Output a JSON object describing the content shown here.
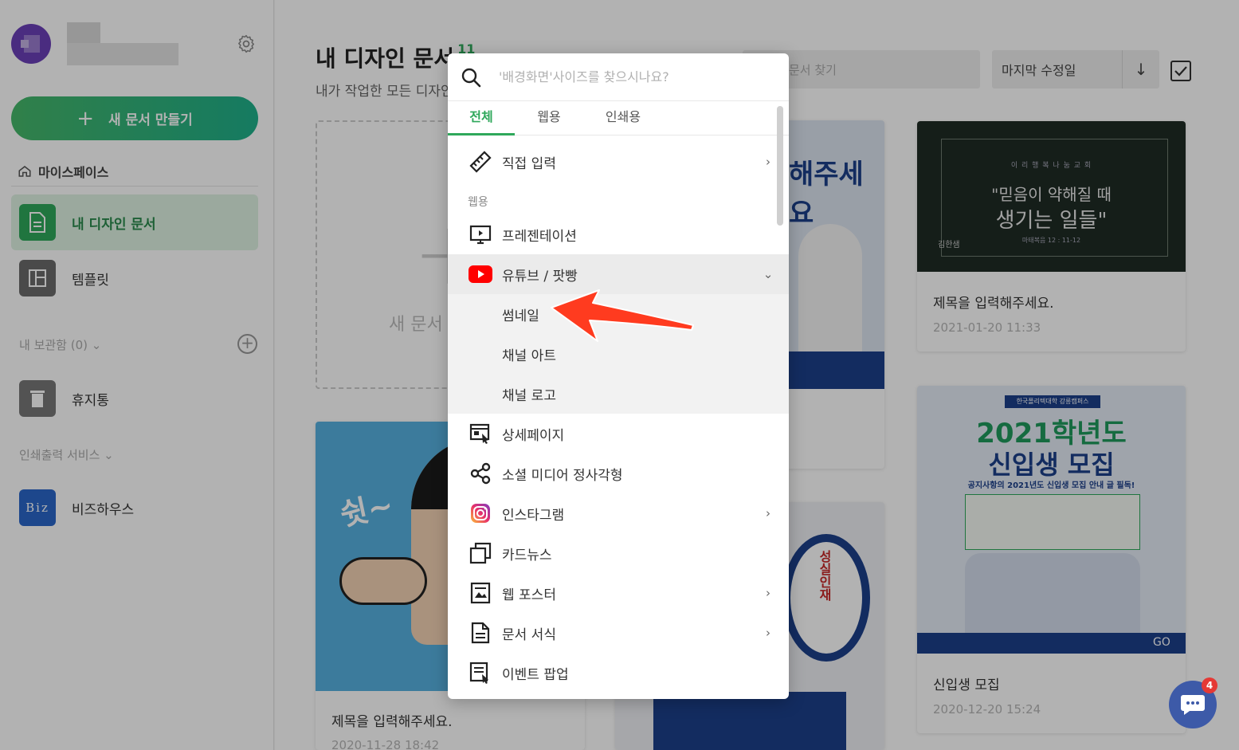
{
  "sidebar": {
    "new_doc_label": "새 문서 만들기",
    "myspace_label": "마이스페이스",
    "nav": [
      {
        "label": "내 디자인 문서"
      },
      {
        "label": "템플릿"
      },
      {
        "label": "휴지통"
      },
      {
        "label": "비즈하우스"
      }
    ],
    "storage_label": "내 보관함 (0)",
    "print_label": "인쇄출력 서비스",
    "biz_icon_text": "Biz"
  },
  "main": {
    "title": "내 디자인 문서",
    "count": "11",
    "subtitle": "내가 작업한 모든 디자인",
    "search_placeholder": "문서 찾기",
    "sort_label": "마지막 수정일",
    "new_card_label": "새 문서",
    "cards": [
      {
        "title": "제목을 입력해주세요.",
        "date": "2021-01-20 11:33"
      },
      {
        "title": "신입생 모집",
        "date": "2020-12-20 15:24"
      },
      {
        "title": "제목을 입력해주세요.",
        "date": "2020-11-28 18:42"
      }
    ],
    "thumb_texts": {
      "church_top": "이 리 행 복 나 눔 교 회",
      "church_line1": "\"믿음이 약해질 때",
      "church_line2": "생기는 일들\"",
      "church_ref": "마태복음 12 : 11-12",
      "church_speaker": "김한샘",
      "poster_text": "해주세요",
      "recruit_school": "한국폴리텍대학 강릉캠퍼스",
      "recruit_year": "2021학년도",
      "recruit_title": "신입생 모집",
      "recruit_sub": "공지사항의 2021년도 신입생 모집 안내 글 필독!",
      "recruit_go": "GO",
      "cartoon_text": "쉿~",
      "campaign_text": "성실인재"
    }
  },
  "popup": {
    "search_placeholder": "'배경화면'사이즈를 찾으시나요?",
    "tabs": [
      "전체",
      "웹용",
      "인쇄용"
    ],
    "direct_input": "직접 입력",
    "group_web": "웹용",
    "items": [
      {
        "label": "프레젠테이션"
      },
      {
        "label": "유튜브 / 팟빵"
      },
      {
        "label": "썸네일"
      },
      {
        "label": "채널 아트"
      },
      {
        "label": "채널 로고"
      },
      {
        "label": "상세페이지"
      },
      {
        "label": "소셜 미디어 정사각형"
      },
      {
        "label": "인스타그램"
      },
      {
        "label": "카드뉴스"
      },
      {
        "label": "웹 포스터"
      },
      {
        "label": "문서 서식"
      },
      {
        "label": "이벤트 팝업"
      }
    ]
  },
  "chat": {
    "badge": "4"
  },
  "colors": {
    "accent": "#2fa85b",
    "arrow": "#ff3b1f",
    "youtube": "#ff0000",
    "chat": "#3d5aa8"
  }
}
